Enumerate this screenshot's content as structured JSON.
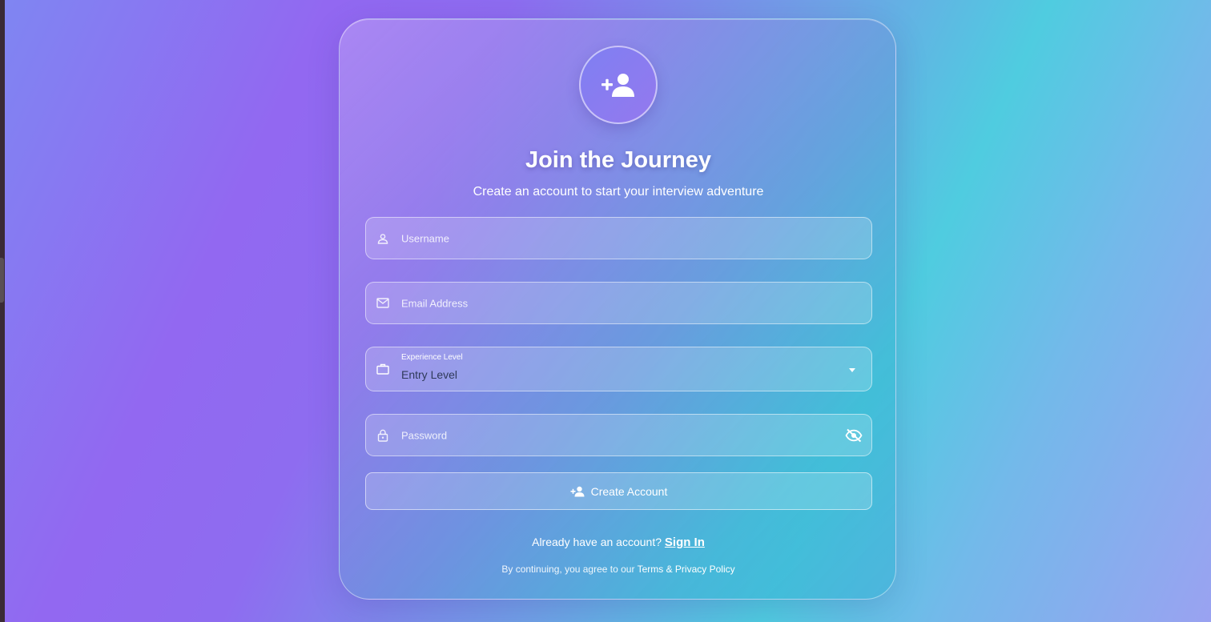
{
  "colors": {
    "card_accent": "#8b7cf0",
    "avatar_gradient_start": "#7f7ff2",
    "avatar_gradient_end": "#9479ee"
  },
  "header": {
    "icon": "person-add-icon",
    "title": "Join the Journey",
    "subtitle": "Create an account to start your interview adventure"
  },
  "form": {
    "username": {
      "placeholder": "Username",
      "value": "",
      "icon": "person-icon"
    },
    "email": {
      "placeholder": "Email Address",
      "value": "",
      "icon": "mail-icon"
    },
    "experience": {
      "label": "Experience Level",
      "value": "Entry Level",
      "icon": "briefcase-icon"
    },
    "password": {
      "placeholder": "Password",
      "value": "",
      "icon": "lock-icon",
      "toggle_icon": "eye-off-icon"
    },
    "submit_label": "Create Account",
    "submit_icon": "person-add-icon"
  },
  "footer": {
    "signin_prompt": "Already have an account?",
    "signin_link": "Sign In",
    "terms_prefix": "By continuing, you agree to our",
    "terms_link": "Terms & Privacy Policy"
  }
}
